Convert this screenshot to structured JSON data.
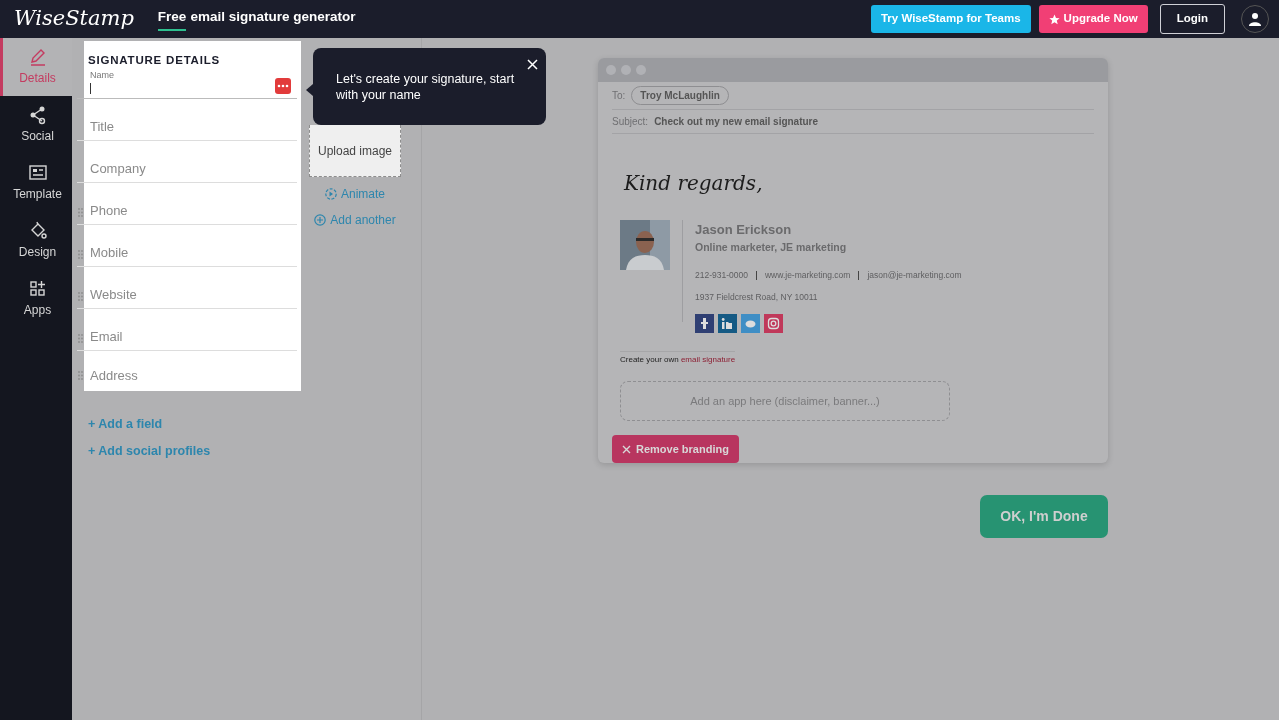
{
  "navbar": {
    "logo": "WiseStamp",
    "title_highlight": "Free",
    "title_rest": "email signature generator",
    "buttons": [
      {
        "label": "Try WiseStamp for Teams",
        "kind": "teams"
      },
      {
        "label": "Upgrade Now",
        "kind": "upgrade"
      },
      {
        "label": "Login",
        "kind": "login"
      }
    ]
  },
  "sidebar": {
    "items": [
      {
        "label": "Details",
        "selected": true
      },
      {
        "label": "Social",
        "selected": false
      },
      {
        "label": "Template",
        "selected": false
      },
      {
        "label": "Design",
        "selected": false
      },
      {
        "label": "Apps",
        "selected": false
      }
    ]
  },
  "details": {
    "heading": "SIGNATURE DETAILS",
    "fields": [
      {
        "label": "Name",
        "focused": true,
        "draggable": false
      },
      {
        "placeholder": "Title",
        "focused": false,
        "draggable": false
      },
      {
        "placeholder": "Company",
        "focused": false,
        "draggable": false
      },
      {
        "placeholder": "Phone",
        "focused": false,
        "draggable": true
      },
      {
        "placeholder": "Mobile",
        "focused": false,
        "draggable": true
      },
      {
        "placeholder": "Website",
        "focused": false,
        "draggable": true
      },
      {
        "placeholder": "Email",
        "focused": false,
        "draggable": true
      },
      {
        "placeholder": "Address",
        "focused": false,
        "draggable": true
      }
    ],
    "links": [
      "+ Add a field",
      "+ Add social profiles"
    ]
  },
  "image": {
    "label": "Upload image",
    "links": [
      {
        "label": "Animate",
        "kind": "animate"
      },
      {
        "label": "Add another",
        "kind": "add"
      }
    ]
  },
  "tooltip": {
    "text": "Let's create your signature, start with your name"
  },
  "preview": {
    "to_label": "To:",
    "to": "Troy McLaughlin",
    "subject_label": "Subject:",
    "subject": "Check out my new email signature",
    "closing": "Kind regards,",
    "signature": {
      "name": "Jason Erickson",
      "title": "Online marketer, JE marketing",
      "phone": "212-931-0000",
      "website": "www.je-marketing.com",
      "email": "jason@je-marketing.com",
      "address": "1937 Fieldcrest Road, NY 10011",
      "socials": [
        {
          "kind": "facebook",
          "color": "#2f3f73"
        },
        {
          "kind": "linkedin",
          "color": "#155a84"
        },
        {
          "kind": "twitter",
          "color": "#3f8ec5"
        },
        {
          "kind": "instagram",
          "color": "#c0385a"
        }
      ]
    },
    "branding_text": "Create your own",
    "branding_link": "email signature",
    "app_placeholder": "Add an app here (disclaimer, banner...)",
    "remove_button": "Remove branding"
  },
  "done_button": "OK, I'm Done"
}
